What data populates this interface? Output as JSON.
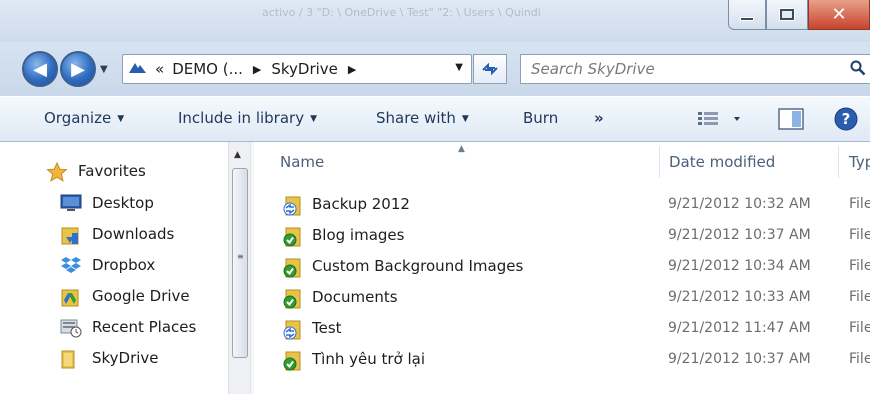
{
  "window": {
    "background_title_text": "activo / 3 \"D: \\ OneDrive \\ Test\" \"2: \\ Users \\ Quindi"
  },
  "address": {
    "crumbs": [
      "DEMO (...",
      "SkyDrive"
    ],
    "prefix": "«"
  },
  "search": {
    "placeholder": "Search SkyDrive"
  },
  "toolbar": {
    "organize": "Organize",
    "include_in_library": "Include in library",
    "share_with": "Share with",
    "burn": "Burn",
    "more": "»"
  },
  "navpane": {
    "favorites_label": "Favorites",
    "items": [
      {
        "label": "Desktop",
        "icon": "desktop-icon"
      },
      {
        "label": "Downloads",
        "icon": "downloads-folder-icon"
      },
      {
        "label": "Dropbox",
        "icon": "dropbox-icon"
      },
      {
        "label": "Google Drive",
        "icon": "google-drive-folder-icon"
      },
      {
        "label": "Recent Places",
        "icon": "recent-places-icon"
      },
      {
        "label": "SkyDrive",
        "icon": "skydrive-folder-icon"
      }
    ]
  },
  "filelist": {
    "columns": {
      "name": "Name",
      "date_modified": "Date modified",
      "type": "Typ"
    },
    "rows": [
      {
        "name": "Backup 2012",
        "date": "9/21/2012 10:32 AM",
        "type": "File",
        "status": "syncing"
      },
      {
        "name": "Blog images",
        "date": "9/21/2012 10:37 AM",
        "type": "File",
        "status": "synced"
      },
      {
        "name": "Custom Background Images",
        "date": "9/21/2012 10:34 AM",
        "type": "File",
        "status": "synced"
      },
      {
        "name": "Documents",
        "date": "9/21/2012 10:33 AM",
        "type": "File",
        "status": "synced"
      },
      {
        "name": "Test",
        "date": "9/21/2012 11:47 AM",
        "type": "File",
        "status": "syncing"
      },
      {
        "name": "Tình yêu trở lại",
        "date": "9/21/2012 10:37 AM",
        "type": "File",
        "status": "synced"
      }
    ]
  },
  "colors": {
    "folder_yellow": "#e9c24a",
    "synced_green": "#2f9e2f",
    "syncing_blue": "#2f6fd0",
    "toolbar_text": "#1e395b"
  }
}
